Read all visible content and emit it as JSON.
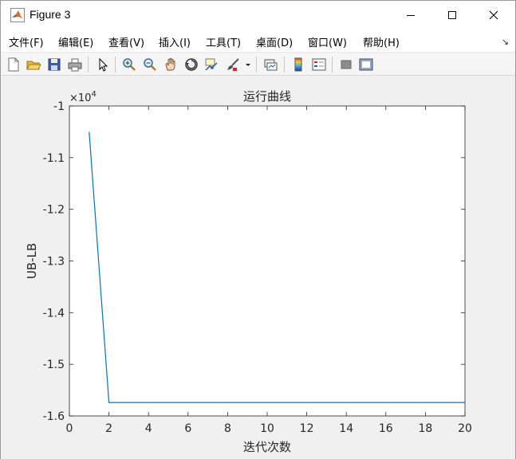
{
  "window": {
    "title": "Figure 3",
    "controls": {
      "minimize": "minimize",
      "maximize": "maximize",
      "close": "close"
    }
  },
  "menu": {
    "items": [
      "文件(F)",
      "编辑(E)",
      "查看(V)",
      "插入(I)",
      "工具(T)",
      "桌面(D)",
      "窗口(W)",
      "帮助(H)"
    ],
    "overflow": "↘"
  },
  "toolbar": {
    "icons": [
      "new-figure-icon",
      "open-icon",
      "save-icon",
      "print-icon",
      "pointer-icon",
      "zoom-in-icon",
      "zoom-out-icon",
      "pan-icon",
      "rotate-icon",
      "data-cursor-icon",
      "brush-icon",
      "link-icon",
      "colorbar-icon",
      "legend-icon",
      "hide-tools-icon",
      "show-tools-icon"
    ]
  },
  "colors": {
    "line": "#0072bd",
    "axes_bg": "#ffffff",
    "figure_bg": "#f0f0f0"
  },
  "chart_data": {
    "type": "line",
    "title": "运行曲线",
    "xlabel": "迭代次数",
    "ylabel": "UB-LB",
    "exponent_label": "×10",
    "exponent_power": "4",
    "xlim": [
      0,
      20
    ],
    "ylim": [
      -1.6,
      -1.0
    ],
    "y_scale_factor": 10000,
    "xticks": [
      0,
      2,
      4,
      6,
      8,
      10,
      12,
      14,
      16,
      18,
      20
    ],
    "yticks": [
      -1.6,
      -1.5,
      -1.4,
      -1.3,
      -1.2,
      -1.1,
      -1.0
    ],
    "ytick_labels": [
      "-1.6",
      "-1.5",
      "-1.4",
      "-1.3",
      "-1.2",
      "-1.1",
      "-1"
    ],
    "grid": false,
    "series": [
      {
        "x": [
          1,
          2,
          3,
          4,
          5,
          6,
          7,
          8,
          9,
          10,
          11,
          12,
          13,
          14,
          15,
          16,
          17,
          18,
          19,
          20
        ],
        "y": [
          -10500,
          -15740,
          -15740,
          -15740,
          -15740,
          -15740,
          -15740,
          -15740,
          -15740,
          -15740,
          -15740,
          -15740,
          -15740,
          -15740,
          -15740,
          -15740,
          -15740,
          -15740,
          -15740,
          -15740
        ]
      }
    ]
  }
}
